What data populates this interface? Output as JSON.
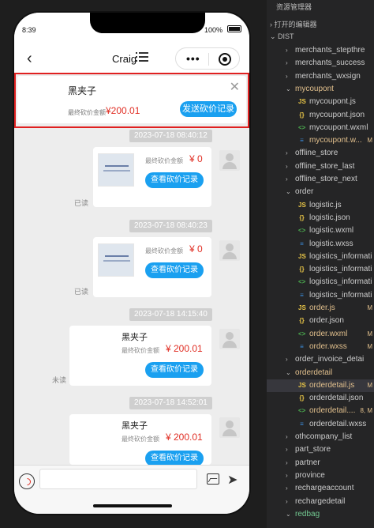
{
  "phone": {
    "status": {
      "time": "8:39",
      "battery": "100%"
    },
    "nav": {
      "back": "‹",
      "title": "Craig",
      "more": "•••"
    },
    "top_card": {
      "name": "黑夹子",
      "close": "✕",
      "label": "最终砍价金额",
      "amount": "¥200.01",
      "button": "发送砍价记录"
    },
    "messages": [
      {
        "time": "2023-07-18 08:40:12",
        "status": "已读",
        "label": "最终砍价金额",
        "amount": "¥ 0",
        "button": "查看砍价记录"
      },
      {
        "time": "2023-07-18 08:40:23",
        "status": "已读",
        "label": "最终砍价金额",
        "amount": "¥ 0",
        "button": "查看砍价记录"
      },
      {
        "time": "2023-07-18 14:15:40",
        "status": "未读",
        "name": "黑夹子",
        "label": "最终砍价金额",
        "amount": "¥ 200.01",
        "button": "查看砍价记录"
      },
      {
        "time": "2023-07-18 14:52:01",
        "name": "黑夹子",
        "label": "最终砍价金额",
        "amount": "¥ 200.01",
        "button": "查看砍价记录"
      }
    ]
  },
  "explorer": {
    "header": "资源管理器",
    "open_editors": "打开的编辑器",
    "root": "DIST",
    "items": [
      {
        "label": "merchants_stepthre",
        "type": "folder",
        "indent": 1
      },
      {
        "label": "merchants_success",
        "type": "folder",
        "indent": 1
      },
      {
        "label": "merchants_wxsign",
        "type": "folder",
        "indent": 1
      },
      {
        "label": "mycoupont",
        "type": "folder-open",
        "indent": 1,
        "color": "#e2c08d"
      },
      {
        "label": "mycoupont.js",
        "type": "js",
        "indent": 2
      },
      {
        "label": "mycoupont.json",
        "type": "json",
        "indent": 2
      },
      {
        "label": "mycoupont.wxml",
        "type": "wxml",
        "indent": 2
      },
      {
        "label": "mycoupont.w...",
        "type": "wxss",
        "indent": 2,
        "badge": "M",
        "color": "#e2c08d"
      },
      {
        "label": "offline_store",
        "type": "folder",
        "indent": 1
      },
      {
        "label": "offline_store_last",
        "type": "folder",
        "indent": 1
      },
      {
        "label": "offline_store_next",
        "type": "folder",
        "indent": 1
      },
      {
        "label": "order",
        "type": "folder-open",
        "indent": 1
      },
      {
        "label": "logistic.js",
        "type": "js",
        "indent": 2
      },
      {
        "label": "logistic.json",
        "type": "json",
        "indent": 2
      },
      {
        "label": "logistic.wxml",
        "type": "wxml",
        "indent": 2
      },
      {
        "label": "logistic.wxss",
        "type": "wxss",
        "indent": 2
      },
      {
        "label": "logistics_informati",
        "type": "js",
        "indent": 2
      },
      {
        "label": "logistics_informati",
        "type": "json",
        "indent": 2
      },
      {
        "label": "logistics_informati",
        "type": "wxml",
        "indent": 2
      },
      {
        "label": "logistics_informati",
        "type": "wxss",
        "indent": 2
      },
      {
        "label": "order.js",
        "type": "js",
        "indent": 2,
        "badge": "M",
        "color": "#e2c08d"
      },
      {
        "label": "order.json",
        "type": "json",
        "indent": 2
      },
      {
        "label": "order.wxml",
        "type": "wxml",
        "indent": 2,
        "badge": "M",
        "color": "#e2c08d"
      },
      {
        "label": "order.wxss",
        "type": "wxss",
        "indent": 2,
        "badge": "M",
        "color": "#e2c08d"
      },
      {
        "label": "order_invoice_detai",
        "type": "folder",
        "indent": 1
      },
      {
        "label": "orderdetail",
        "type": "folder-open",
        "indent": 1,
        "color": "#e2c08d"
      },
      {
        "label": "orderdetail.js",
        "type": "js",
        "indent": 2,
        "badge": "M",
        "color": "#e2c08d",
        "selected": true
      },
      {
        "label": "orderdetail.json",
        "type": "json",
        "indent": 2
      },
      {
        "label": "orderdetail....",
        "type": "wxml",
        "indent": 2,
        "badge": "8, M",
        "color": "#e2c08d"
      },
      {
        "label": "orderdetail.wxss",
        "type": "wxss",
        "indent": 2
      },
      {
        "label": "othcompany_list",
        "type": "folder",
        "indent": 1
      },
      {
        "label": "part_store",
        "type": "folder",
        "indent": 1
      },
      {
        "label": "partner",
        "type": "folder",
        "indent": 1
      },
      {
        "label": "province",
        "type": "folder",
        "indent": 1
      },
      {
        "label": "rechargeaccount",
        "type": "folder",
        "indent": 1
      },
      {
        "label": "rechargedetail",
        "type": "folder",
        "indent": 1
      },
      {
        "label": "redbag",
        "type": "folder-open",
        "indent": 1,
        "color": "#73c991"
      }
    ]
  },
  "colors": {
    "accent": "#1aa0f0",
    "price": "#e02e24",
    "highlight": "#e02020",
    "modified": "#e2c08d"
  }
}
